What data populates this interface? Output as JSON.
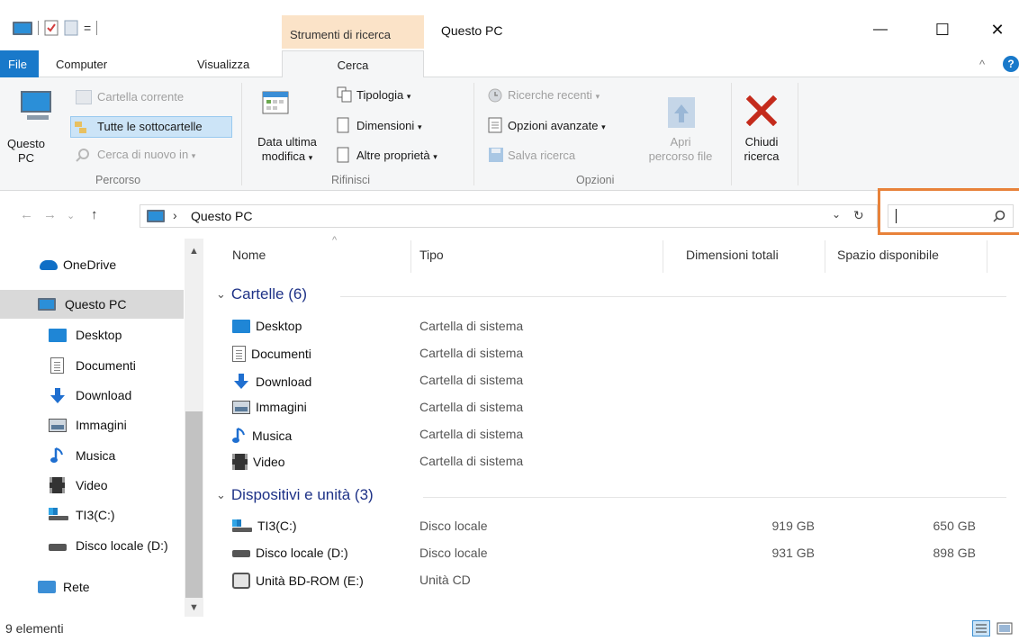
{
  "titlebar": {
    "context_tab": "Strumenti di ricerca",
    "window_title": "Questo PC",
    "qat_dropdown": "=",
    "minimize": "—",
    "maximize": "☐",
    "close": "✕",
    "help": "?"
  },
  "tabs": {
    "file": "File",
    "computer": "Computer",
    "visualizza": "Visualizza",
    "cerca": "Cerca",
    "collapse": "^"
  },
  "ribbon": {
    "location_button": "Questo PC",
    "location_button_line1": "Questo",
    "location_button_line2": "PC",
    "cartella_corrente": "Cartella corrente",
    "tutte_sottocartelle": "Tutte le sottocartelle",
    "cerca_di_nuovo": "Cerca di nuovo in",
    "group_percorso": "Percorso",
    "data_ultima_1": "Data ultima",
    "data_ultima_2": "modifica",
    "tipologia": "Tipologia",
    "dimensioni": "Dimensioni",
    "altre_proprieta": "Altre proprietà",
    "group_rifinisci": "Rifinisci",
    "ricerche_recenti": "Ricerche recenti",
    "opzioni_avanzate": "Opzioni avanzate",
    "salva_ricerca": "Salva ricerca",
    "apri_1": "Apri",
    "apri_2": "percorso file",
    "group_opzioni": "Opzioni",
    "chiudi_1": "Chiudi",
    "chiudi_2": "ricerca"
  },
  "address": {
    "path": "Questo PC",
    "search_value": ""
  },
  "sidebar": {
    "items": [
      {
        "label": "OneDrive",
        "icon": "onedrive-icon"
      },
      {
        "label": "Questo PC",
        "icon": "computer-icon"
      },
      {
        "label": "Desktop",
        "icon": "desktop-folder-icon"
      },
      {
        "label": "Documenti",
        "icon": "documents-icon"
      },
      {
        "label": "Download",
        "icon": "download-arrow-icon"
      },
      {
        "label": "Immagini",
        "icon": "pictures-icon"
      },
      {
        "label": "Musica",
        "icon": "music-note-icon"
      },
      {
        "label": "Video",
        "icon": "video-icon"
      },
      {
        "label": "TI3(C:)",
        "icon": "windows-drive-icon"
      },
      {
        "label": "Disco locale (D:)",
        "icon": "drive-icon"
      },
      {
        "label": "Rete",
        "icon": "network-icon"
      }
    ]
  },
  "columns": {
    "name": "Nome",
    "type": "Tipo",
    "total": "Dimensioni totali",
    "free": "Spazio disponibile"
  },
  "groups": {
    "folders": "Cartelle (6)",
    "devices": "Dispositivi e unità (3)"
  },
  "folders": [
    {
      "name": "Desktop",
      "type": "Cartella di sistema",
      "icon": "desktop-folder-icon"
    },
    {
      "name": "Documenti",
      "type": "Cartella di sistema",
      "icon": "documents-icon"
    },
    {
      "name": "Download",
      "type": "Cartella di sistema",
      "icon": "download-arrow-icon"
    },
    {
      "name": "Immagini",
      "type": "Cartella di sistema",
      "icon": "pictures-icon"
    },
    {
      "name": "Musica",
      "type": "Cartella di sistema",
      "icon": "music-note-icon"
    },
    {
      "name": "Video",
      "type": "Cartella di sistema",
      "icon": "video-icon"
    }
  ],
  "devices": [
    {
      "name": "TI3(C:)",
      "type": "Disco locale",
      "total": "919 GB",
      "free": "650 GB",
      "icon": "windows-drive-icon"
    },
    {
      "name": "Disco locale (D:)",
      "type": "Disco locale",
      "total": "931 GB",
      "free": "898 GB",
      "icon": "drive-icon"
    },
    {
      "name": "Unità BD-ROM (E:)",
      "type": "Unità CD",
      "total": "",
      "free": "",
      "icon": "optical-drive-icon"
    }
  ],
  "status": {
    "count": "9 elementi"
  },
  "colors": {
    "file_tab": "#1979ca",
    "context_tab": "#fbe3c8",
    "search_highlight": "#e8823a",
    "close_x": "#c42b1c",
    "group_header": "#1e3287"
  }
}
